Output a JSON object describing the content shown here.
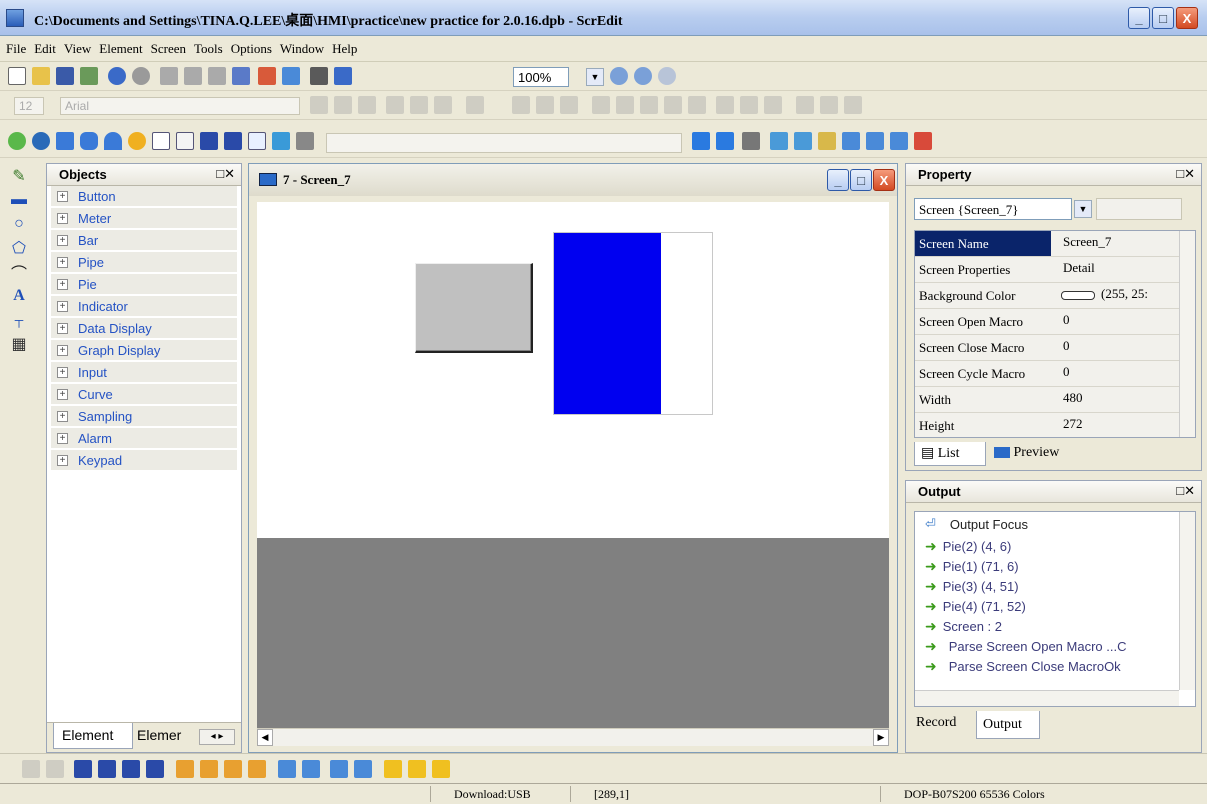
{
  "window": {
    "title": "C:\\Documents and Settings\\TINA.Q.LEE\\桌面\\HMI\\practice\\new practice for 2.0.16.dpb - ScrEdit",
    "minimize": "_",
    "maximize": "□",
    "close": "X"
  },
  "menu": [
    "File",
    "Edit",
    "View",
    "Element",
    "Screen",
    "Tools",
    "Options",
    "Window",
    "Help"
  ],
  "toolbar": {
    "zoom_value": "100%",
    "font_size": "12",
    "font_name": "Arial"
  },
  "objects_panel": {
    "title": "Objects",
    "items": [
      "Button",
      "Meter",
      "Bar",
      "Pipe",
      "Pie",
      "Indicator",
      "Data Display",
      "Graph Display",
      "Input",
      "Curve",
      "Sampling",
      "Alarm",
      "Keypad"
    ],
    "tabs": [
      "Element",
      "Elemer"
    ]
  },
  "screen_window": {
    "title": "7 - Screen_7"
  },
  "property_panel": {
    "title": "Property",
    "selector": "Screen {Screen_7}",
    "rows": [
      {
        "key": "Screen Name",
        "value": "Screen_7"
      },
      {
        "key": "Screen Properties",
        "value": "Detail"
      },
      {
        "key": "Background Color",
        "value": "(255, 25:"
      },
      {
        "key": "Screen Open Macro",
        "value": "0"
      },
      {
        "key": "Screen Close Macro",
        "value": "0"
      },
      {
        "key": "Screen Cycle Macro",
        "value": "0"
      },
      {
        "key": "Width",
        "value": "480"
      },
      {
        "key": "Height",
        "value": "272"
      }
    ],
    "tabs": [
      "List",
      "Preview"
    ]
  },
  "output_panel": {
    "title": "Output",
    "focus_label": "Output Focus",
    "lines": [
      "Pie(2) (4, 6)",
      "Pie(1) (71, 6)",
      "Pie(3) (4, 51)",
      "Pie(4) (71, 52)",
      "Screen : 2",
      "Parse Screen Open Macro ...C",
      "Parse Screen Close MacroOk"
    ],
    "tabs": [
      "Record",
      "Output"
    ]
  },
  "statusbar": {
    "download": "Download:USB",
    "coords": "[289,1]",
    "device": "DOP-B07S200 65536 Colors"
  },
  "colors": {
    "blue_rect": "#0000f0",
    "gray_button": "#c0c0c0",
    "link_blue": "#2452c4"
  }
}
